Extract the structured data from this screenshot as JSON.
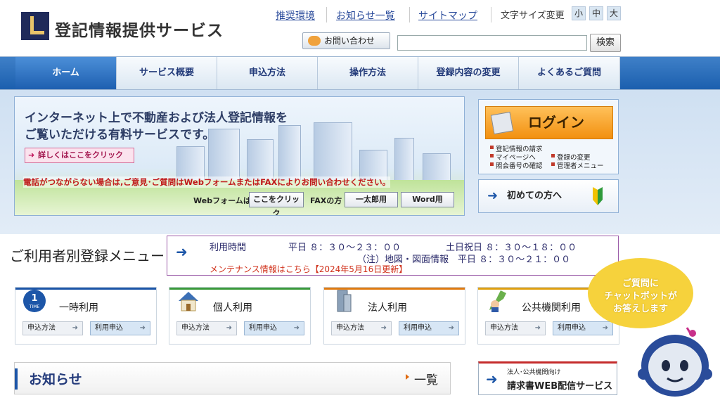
{
  "header": {
    "site_title": "登記情報提供サービス",
    "links": [
      "推奨環境",
      "お知らせ一覧",
      "サイトマップ"
    ],
    "font_size_label": "文字サイズ変更",
    "font_sizes": [
      "小",
      "中",
      "大"
    ],
    "contact_label": "お問い合わせ",
    "search_value": "",
    "search_button": "検索"
  },
  "nav": {
    "items": [
      "ホーム",
      "サービス概要",
      "申込方法",
      "操作方法",
      "登録内容の変更",
      "よくあるご質問"
    ],
    "active": "ホーム"
  },
  "banner": {
    "line1": "インターネット上で不動産および法人登記情報を",
    "line2": "ご覧いただける有料サービスです。",
    "detail_button": "詳しくはここをクリック",
    "phone_note": "電話がつながらない場合は,ご意見･ご質問はWebフォームまたはFAXによりお問い合わせください。",
    "webform_label": "Webフォームは",
    "webform_button": "ここをクリック",
    "fax_label": "FAXの方",
    "ichitaro_button": "一太郎用",
    "word_button": "Word用"
  },
  "login": {
    "button": "ログイン",
    "links": [
      "登記情報の請求",
      "マイページへ",
      "登録の変更",
      "照会番号の確認",
      "管理者メニュー"
    ],
    "first_time": "初めての方へ"
  },
  "registration": {
    "title": "ご利用者別登録メニュー",
    "hours_label": "利用時間",
    "weekday": "平日 ８：３０～２３：００",
    "weekend": "土日祝日 ８：３０～１８：００",
    "map_note": "（注）地図・図面情報　平日 ８：３０～２１：００",
    "maintenance": "メンテナンス情報はこちら【2024年5月16日更新】"
  },
  "user_cards": [
    {
      "title": "一時利用",
      "badge_number": "1",
      "badge_text": "TIME",
      "btn1": "申込方法",
      "btn2": "利用申込",
      "color": "#1d56a8"
    },
    {
      "title": "個人利用",
      "btn1": "申込方法",
      "btn2": "利用申込",
      "color": "#3a9a3a"
    },
    {
      "title": "法人利用",
      "btn1": "申込方法",
      "btn2": "利用申込",
      "color": "#e07a10"
    },
    {
      "title": "公共機関利用",
      "btn1": "申込方法",
      "btn2": "利用申込",
      "color": "#e0a010"
    }
  ],
  "notice": {
    "title": "お知らせ",
    "list_link": "一覧"
  },
  "invoice": {
    "small": "法人･公共機関向け",
    "big": "請求書WEB配信サービス"
  },
  "chatbot": {
    "line1": "ご質問に",
    "line2": "チャットボットが",
    "line3": "お答えします"
  },
  "icons": [
    "logo-icon",
    "phone-icon",
    "arrow-right-icon",
    "beginner-leaf-icon",
    "house-icon",
    "building-icon",
    "japan-map-icon",
    "robot-icon"
  ]
}
